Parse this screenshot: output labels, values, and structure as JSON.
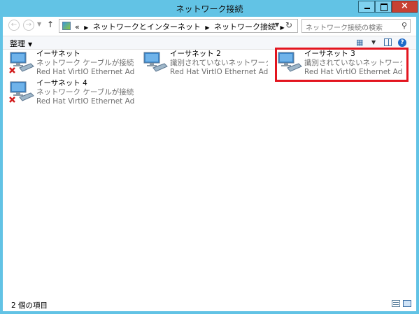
{
  "window": {
    "title": "ネットワーク接続",
    "close_glyph": "×"
  },
  "address": {
    "overflow": "«",
    "crumbs": [
      "ネットワークとインターネット",
      "ネットワーク接続"
    ],
    "search_placeholder": "ネットワーク接続の検索"
  },
  "toolbar": {
    "organize_label": "整理"
  },
  "connections": [
    {
      "name": "イーサネット",
      "status": "ネットワーク ケーブルが接続されていま...",
      "device": "Red Hat VirtIO Ethernet Adap...",
      "disconnected": true
    },
    {
      "name": "イーサネット 2",
      "status": "識別されていないネットワーク",
      "device": "Red Hat VirtIO Ethernet Adap...",
      "disconnected": false
    },
    {
      "name": "イーサネット 3",
      "status": "識別されていないネットワーク",
      "device": "Red Hat VirtIO Ethernet Adap...",
      "disconnected": false,
      "highlighted": true
    },
    {
      "name": "イーサネット 4",
      "status": "ネットワーク ケーブルが接続されていま...",
      "device": "Red Hat VirtIO Ethernet Adap...",
      "disconnected": true
    }
  ],
  "status": {
    "item_count": "2 個の項目"
  },
  "colors": {
    "title_bar": "#62c3e5",
    "highlight_border": "#e3151f",
    "close_button": "#c74133"
  }
}
